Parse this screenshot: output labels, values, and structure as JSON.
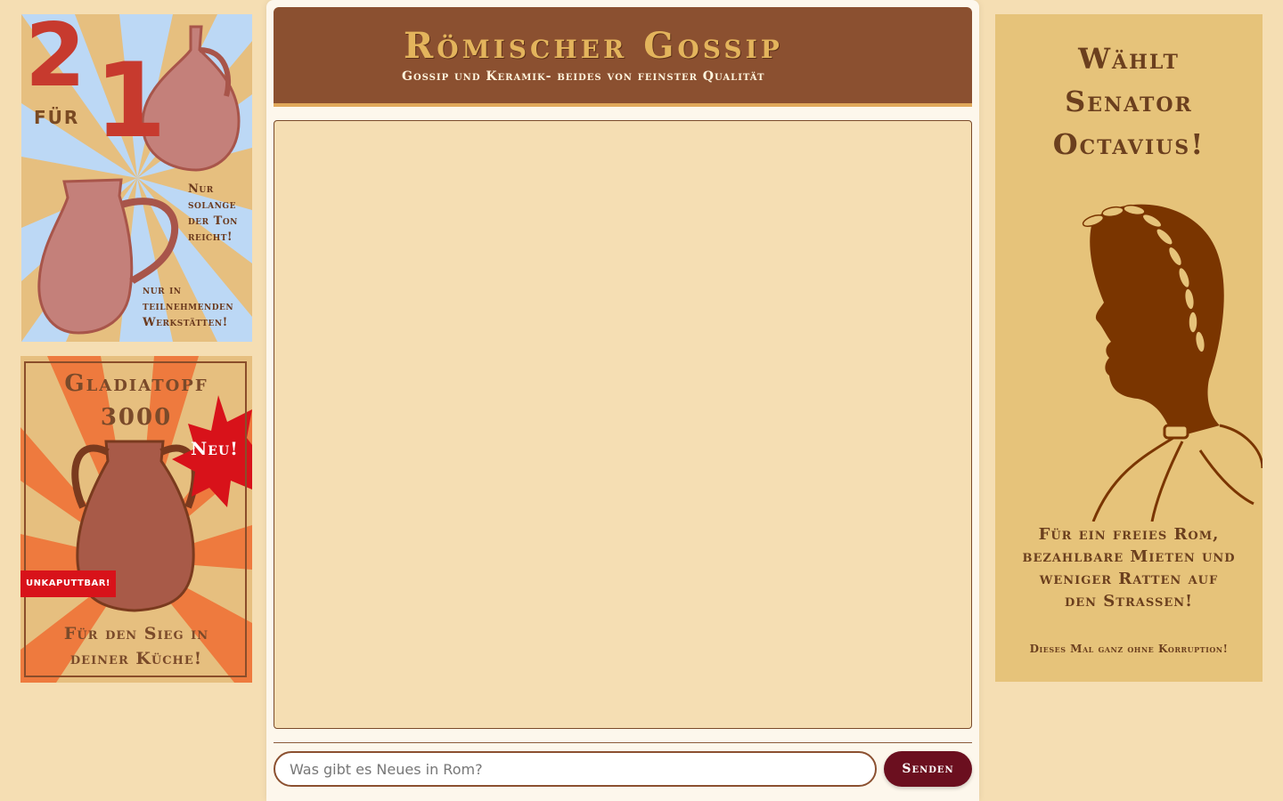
{
  "header": {
    "title": "Römischer Gossip",
    "subtitle": "Gossip und Keramik- beides von feinster Qualität"
  },
  "composer": {
    "placeholder": "Was gibt es Neues in Rom?",
    "value": "",
    "send_label": "Senden"
  },
  "ads": {
    "left_top": {
      "big_two": "2",
      "big_one": "1",
      "fuer": "FÜR",
      "line1": "Nur",
      "line2": "solange",
      "line3": "der Ton",
      "line4": "reicht!",
      "line5": "nur in",
      "line6": "teilnehmenden",
      "line7": "Werkstätten!"
    },
    "left_bottom": {
      "title_line1": "Gladiatopf",
      "title_line2": "3000",
      "badge": "Neu!",
      "ribbon": "UNKAPUTTBAR!",
      "bottom_line1": "Für den Sieg in",
      "bottom_line2": "deiner Küche!"
    },
    "right": {
      "title_line1": "Wählt",
      "title_line2": "Senator",
      "title_line3": "Octavius!",
      "slogan_line1": "Für ein freies Rom,",
      "slogan_line2": "bezahlbare Mieten und",
      "slogan_line3": "weniger Ratten auf",
      "slogan_line4": "den Strassen!",
      "footer": "Dieses Mal ganz ohne Korruption!"
    }
  },
  "colors": {
    "page_bg": "#f5deb3",
    "header_bg": "#8b5030",
    "header_title": "#e3b45c",
    "send_button": "#6b0f1f",
    "ad_red": "#c73a2e"
  }
}
